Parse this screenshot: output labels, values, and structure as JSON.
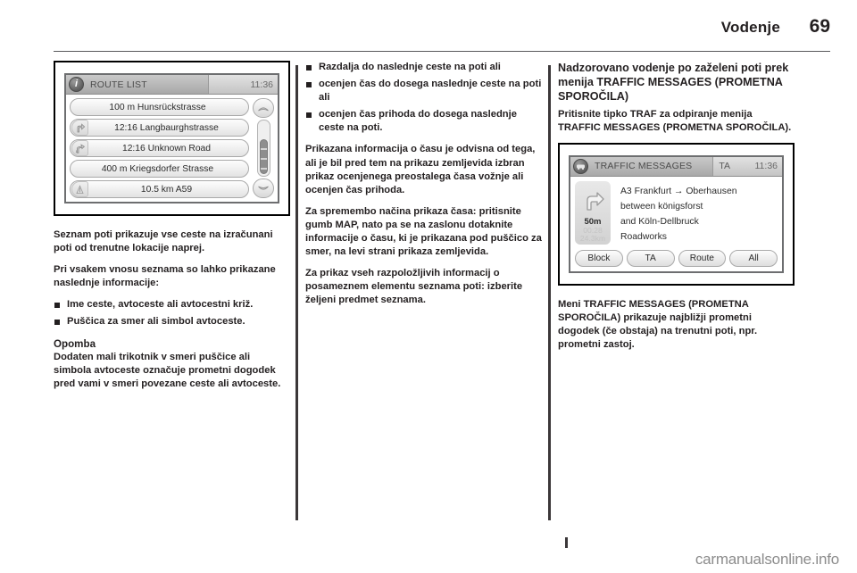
{
  "header": {
    "title": "Vodenje",
    "page_number": "69"
  },
  "footer": {
    "watermark": "carmanualsonline.info"
  },
  "route_list_screen": {
    "icon": "info-icon",
    "title": "ROUTE LIST",
    "clock": "11:36",
    "rows": [
      {
        "icon": "",
        "text": "100 m  Hunsrückstrasse"
      },
      {
        "icon": "turn-right-icon",
        "text": "12:16  Langbaurghstrasse"
      },
      {
        "icon": "merge-road-icon",
        "text": "12:16  Unknown Road"
      },
      {
        "icon": "",
        "text": "400 m  Kriegsdorfer Strasse"
      },
      {
        "icon": "motorway-icon",
        "text": "10.5 km  A59"
      }
    ],
    "scroll_up": "scroll-up-icon",
    "scroll_down": "scroll-down-icon"
  },
  "traffic_messages_screen": {
    "icon": "traffic-icon",
    "title": "TRAFFIC MESSAGES",
    "ta_label": "TA",
    "clock": "11:36",
    "turn_panel": {
      "arrow": "turn-right-arrow-icon",
      "distance": "50m",
      "eta": "00:28",
      "remaining": "24.3km"
    },
    "message_lines": [
      "A3 Frankfurt → Oberhausen",
      "between königsforst",
      "and Köln-Dellbruck",
      "Roadworks"
    ],
    "buttons": [
      "Block",
      "TA",
      "Route",
      "All"
    ]
  },
  "column1": {
    "p1": "Seznam poti prikazuje vse ceste na izračunani poti od trenutne lokacije naprej.",
    "p2": "Pri vsakem vnosu seznama so lahko prikazane naslednje informacije:",
    "bullets": [
      "Ime ceste, avtoceste ali avtocestni križ.",
      "Puščica za smer ali simbol avtoceste."
    ],
    "note_title": "Opomba",
    "note_body": "Dodaten mali trikotnik v smeri puščice ali simbola avtoceste označuje prometni dogodek pred vami v smeri povezane ceste ali avtoceste."
  },
  "column2": {
    "bullets": [
      "Razdalja do naslednje ceste na poti ali",
      "ocenjen čas do dosega naslednje ceste na poti ali",
      "ocenjen čas prihoda do dosega naslednje ceste na poti."
    ],
    "p1": "Prikazana informacija o času je odvisna od tega, ali je bil pred tem na prikazu zemljevida izbran prikaz ocenjenega preostalega časa vožnje ali ocenjen čas prihoda.",
    "p2": "Za spremembo načina prikaza časa: pritisnite gumb MAP, nato pa se na zaslonu dotaknite informacije o času, ki je prikazana pod puščico za smer, na levi strani prikaza zemljevida.",
    "p3": "Za prikaz vseh razpoložljivih informacij o posameznem elementu seznama poti: izberite željeni predmet seznama."
  },
  "column3": {
    "heading": "Nadzorovano vodenje po zaželeni poti prek menija TRAFFIC MESSAGES (PROMETNA SPOROČILA)",
    "p1": "Pritisnite tipko TRAF za odpiranje menija TRAFFIC MESSAGES (PROMETNA SPOROČILA).",
    "p2": "Meni TRAFFIC MESSAGES (PROMETNA SPOROČILA) prikazuje najbližji prometni dogodek (če obstaja) na trenutni poti, npr. prometni zastoj."
  }
}
